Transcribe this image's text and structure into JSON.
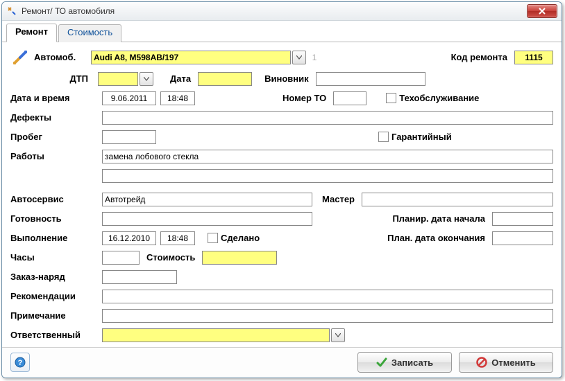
{
  "window": {
    "title": "Ремонт/ ТО автомобиля"
  },
  "tabs": {
    "repair": "Ремонт",
    "cost": "Стоимость"
  },
  "labels": {
    "auto": "Автомоб.",
    "dtp": "ДТП",
    "date": "Дата",
    "culprit": "Виновник",
    "repair_code": "Код ремонта",
    "datetime": "Дата и время",
    "defects": "Дефекты",
    "mileage": "Пробег",
    "works": "Работы",
    "service": "Автосервис",
    "master": "Мастер",
    "readiness": "Готовность",
    "plan_start": "Планир. дата начала",
    "done": "Выполнение",
    "done_chk": "Сделано",
    "plan_end": "План. дата окончания",
    "hours": "Часы",
    "cost": "Стоимость",
    "order": "Заказ-наряд",
    "recs": "Рекомендации",
    "note": "Примечание",
    "responsible": "Ответственный",
    "number_to": "Номер ТО",
    "maintenance": "Техобслуживание",
    "warranty": "Гарантийный"
  },
  "values": {
    "auto": "Audi A8, M598AB/197",
    "auto_index": "1",
    "repair_code": "1115",
    "dtp": "",
    "dtp_date": "",
    "culprit": "",
    "date": "9.06.2011",
    "time": "18:48",
    "number_to": "",
    "defects": "",
    "mileage": "",
    "works_1": "замена лобового стекла",
    "works_2": "",
    "service": "Автотрейд",
    "master": "",
    "readiness": "",
    "plan_start": "",
    "done_date": "16.12.2010",
    "done_time": "18:48",
    "plan_end": "",
    "hours": "",
    "cost": "",
    "order": "",
    "recs": "",
    "note": "",
    "responsible": ""
  },
  "checkboxes": {
    "maintenance": false,
    "warranty": false,
    "done": false
  },
  "buttons": {
    "save": "Записать",
    "cancel": "Отменить"
  }
}
